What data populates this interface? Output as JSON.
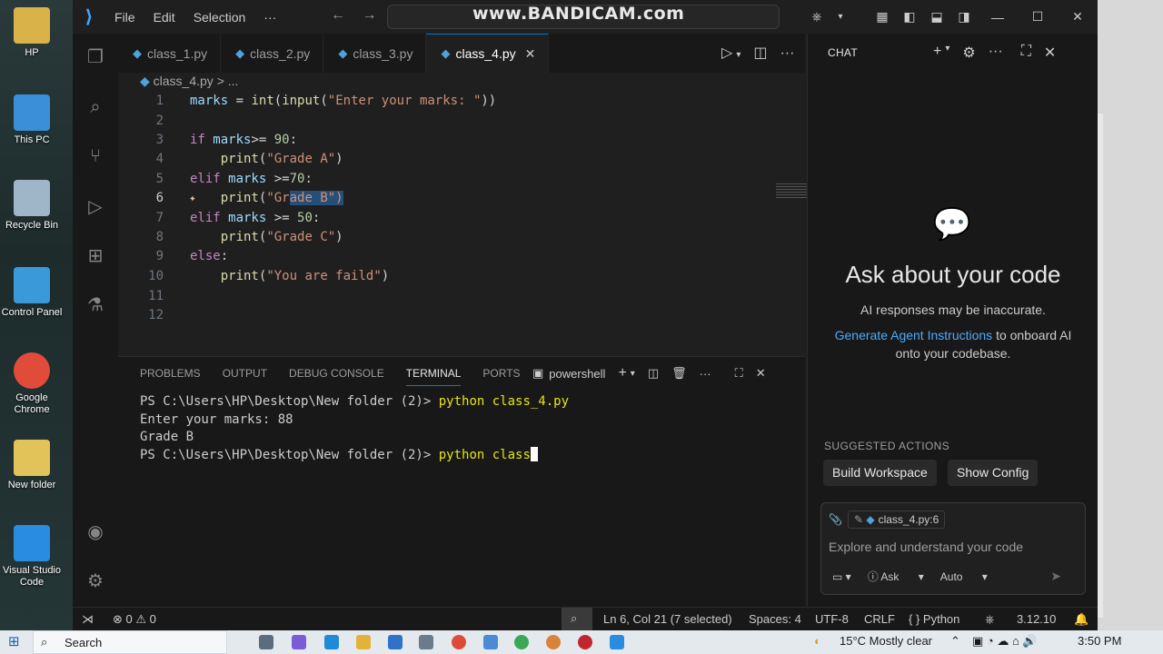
{
  "desktop": {
    "icons": [
      {
        "label": "HP",
        "color": "#d9b24a"
      },
      {
        "label": "This PC",
        "color": "#3b8fd9"
      },
      {
        "label": "Recycle Bin",
        "color": "#9fb6c8"
      },
      {
        "label": "Control Panel",
        "color": "#3a9ad9"
      },
      {
        "label": "Google Chrome",
        "color": "#e04b3a"
      },
      {
        "label": "New folder",
        "color": "#e1c35a"
      },
      {
        "label": "Visual Studio Code",
        "color": "#2a8ce0"
      }
    ]
  },
  "titlebar": {
    "menu": [
      "File",
      "Edit",
      "Selection",
      "···"
    ],
    "watermark": "www.BANDICAM.com"
  },
  "tabs": [
    {
      "label": "class_1.py",
      "active": false
    },
    {
      "label": "class_2.py",
      "active": false
    },
    {
      "label": "class_3.py",
      "active": false
    },
    {
      "label": "class_4.py",
      "active": true
    }
  ],
  "breadcrumb": "class_4.py > ...",
  "code": {
    "lines": [
      {
        "n": "1",
        "text": "marks = int(input(\"Enter your marks: \"))"
      },
      {
        "n": "2",
        "text": ""
      },
      {
        "n": "3",
        "text": "if marks>= 90:"
      },
      {
        "n": "4",
        "text": "    print(\"Grade A\")"
      },
      {
        "n": "5",
        "text": "elif marks >=70:"
      },
      {
        "n": "6",
        "text": "    print(\"Grade B\")"
      },
      {
        "n": "7",
        "text": "elif marks >= 50:"
      },
      {
        "n": "8",
        "text": "    print(\"Grade C\")"
      },
      {
        "n": "9",
        "text": "else:"
      },
      {
        "n": "10",
        "text": "    print(\"You are faild\")"
      },
      {
        "n": "11",
        "text": ""
      },
      {
        "n": "12",
        "text": ""
      }
    ]
  },
  "panel": {
    "tabs": [
      "PROBLEMS",
      "OUTPUT",
      "DEBUG CONSOLE",
      "TERMINAL",
      "PORTS"
    ],
    "active_tab": "TERMINAL",
    "shell": "powershell",
    "terminal": {
      "line1_prompt": "PS C:\\Users\\HP\\Desktop\\New folder (2)> ",
      "line1_cmd": "python class_4.py",
      "line2": "Enter your marks: 88",
      "line3": "Grade B",
      "line4_prompt": "PS C:\\Users\\HP\\Desktop\\New folder (2)> ",
      "line4_cmd": "python class"
    }
  },
  "chat": {
    "title": "CHAT",
    "heading": "Ask about your code",
    "subtext": "AI responses may be inaccurate.",
    "link": "Generate Agent Instructions",
    "link_suffix": " to onboard AI onto your codebase.",
    "suggested_label": "SUGGESTED ACTIONS",
    "suggestions": [
      "Build Workspace",
      "Show Config"
    ],
    "context_chip": "class_4.py:6",
    "placeholder": "Explore and understand your code",
    "mode": "Ask",
    "model": "Auto"
  },
  "status": {
    "errors": "0",
    "warnings": "0",
    "position": "Ln 6, Col 21 (7 selected)",
    "spaces": "Spaces: 4",
    "encoding": "UTF-8",
    "eol": "CRLF",
    "language": "Python",
    "version": "3.12.10"
  },
  "taskbar": {
    "search": "Search",
    "weather": "15°C  Mostly clear",
    "time": "3:50 PM"
  }
}
